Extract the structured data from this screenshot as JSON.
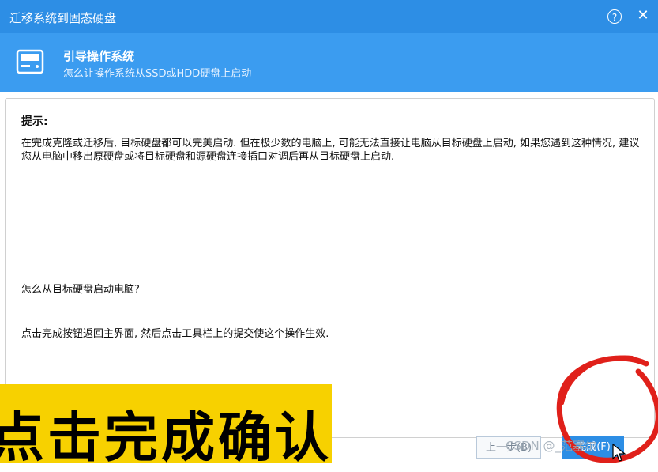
{
  "window": {
    "title": "迁移系统到固态硬盘",
    "help_icon": "question-circle-icon",
    "close_icon": "close-icon",
    "help_glyph": "?",
    "close_glyph": "✕"
  },
  "header": {
    "icon": "disk-drive-icon",
    "title": "引导操作系统",
    "subtitle": "怎么让操作系统从SSD或HDD硬盘上启动"
  },
  "content": {
    "tip_heading": "提示:",
    "tip_body": "在完成克隆或迁移后, 目标硬盘都可以完美启动. 但在极少数的电脑上, 可能无法直接让电脑从目标硬盘上启动, 如果您遇到这种情况, 建议您从电脑中移出原硬盘或将目标硬盘和源硬盘连接插口对调后再从目标硬盘上启动.",
    "question": "怎么从目标硬盘启动电脑?",
    "answer": "点击完成按钮返回主界面, 然后点击工具栏上的提交使这个操作生效."
  },
  "buttons": {
    "back_label": "上一步(B)",
    "finish_label": "完成(F)"
  },
  "overlay": {
    "banner_text": "点击完成确认",
    "banner_color": "#f7d100",
    "annotation_color": "#e0201a",
    "watermark": "CSDN @_范塞尔"
  },
  "colors": {
    "titlebar": "#2d8ee5",
    "header": "#3b9cf0",
    "accent": "#2d8ee5"
  }
}
